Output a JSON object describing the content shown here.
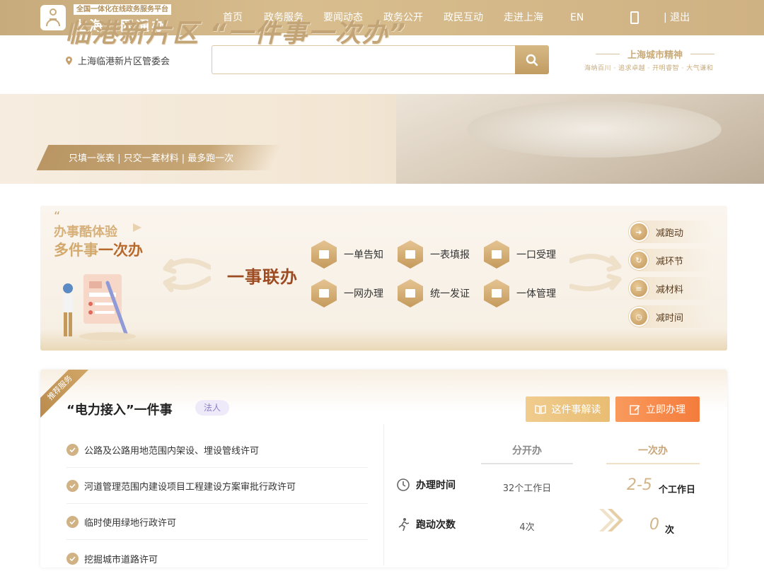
{
  "header": {
    "platform_sub": "全国一体化在线政务服务平台",
    "platform_title": "上海一网通办",
    "nav": [
      "首页",
      "政务服务",
      "要闻动态",
      "政务公开",
      "政民互动",
      "走进上海",
      "EN"
    ],
    "active_nav": "政务服务",
    "logout_label": "| 退出"
  },
  "search": {
    "location": "上海临港新片区管委会",
    "placeholder": ""
  },
  "spirit": {
    "title": "上海城市精神",
    "motto": "海纳百川 · 追求卓越 · 开明睿智 · 大气谦和"
  },
  "banner": {
    "title": "临港新片区 “一件事一次办”",
    "slogan": "只填一张表  |  只交一套材料  |  最多跑一次"
  },
  "feature": {
    "line1": "办事酷体验",
    "line2_prefix": "多件事",
    "line2_emph": "一次办",
    "center": "一事联办",
    "items": [
      "一单告知",
      "一表填报",
      "一口受理",
      "一网办理",
      "统一发证",
      "一体管理"
    ],
    "reductions": [
      "减跑动",
      "减环节",
      "减材料",
      "减时间"
    ]
  },
  "service": {
    "ribbon": "推荐服务",
    "title": "“电力接入”一件事",
    "tag": "法人",
    "btn_explain": "这件事解读",
    "btn_apply": "立即办理",
    "items": [
      "公路及公路用地范围内架设、埋设管线许可",
      "河道管理范围内建设项目工程建设方案审批行政许可",
      "临时使用绿地行政许可",
      "挖掘城市道路许可"
    ],
    "compare": {
      "col_separate": "分开办",
      "col_once": "一次办",
      "rows": [
        {
          "label": "办理时间",
          "separate": "32个工作日",
          "once_value": "2-5",
          "once_unit": "个工作日"
        },
        {
          "label": "跑动次数",
          "separate": "4次",
          "once_value": "0",
          "once_unit": "次"
        }
      ]
    }
  },
  "colors": {
    "brand_gold": "#c8ab7c",
    "accent_brown": "#9c4b22",
    "apply_orange": "#f47c3c"
  }
}
